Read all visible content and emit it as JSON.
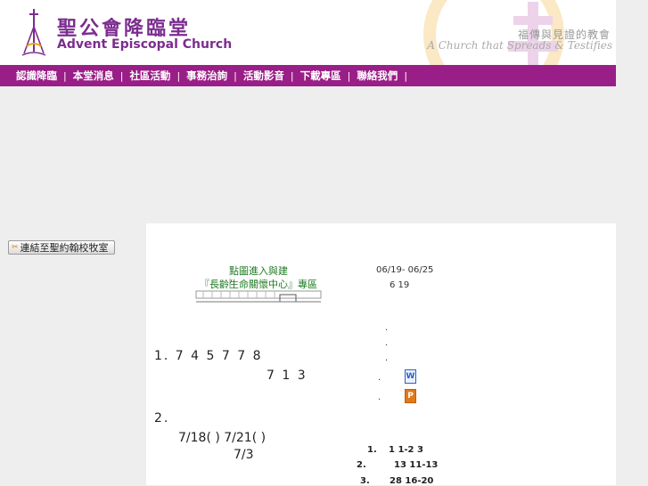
{
  "header": {
    "church_name_cn": "聖公會降臨堂",
    "church_name_en": "Advent Episcopal Church",
    "slogan_cn": "福傳與見證的教會",
    "slogan_en": "A Church that Spreads & Testifies"
  },
  "nav": {
    "items": [
      "認識降臨",
      "本堂消息",
      "社區活動",
      "事務治詢",
      "活動影音",
      "下載專區",
      "聯絡我們"
    ],
    "separator": "|"
  },
  "sidebar": {
    "link_button_label": "連結至聖約翰校牧室"
  },
  "content": {
    "banner_line1": "點圖進入與建",
    "banner_line2": "『長齡生命關懷中心』專區",
    "date_range": "06/19- 06/25",
    "date_sub": "6 19",
    "dot": ".",
    "word_icon_glyph": "W",
    "ppt_icon_glyph": "P",
    "item1_line1": "1. 7 4    5    7 7    8",
    "item1_line2": "7 1   3",
    "item2_line1": "2.",
    "item2_line2": "7/18( ) 7/21( )",
    "item2_line3": "7/3",
    "schedule": [
      {
        "num": "1.",
        "text": "1  1-2  3"
      },
      {
        "num": "2.",
        "text": "13  11-13"
      },
      {
        "num": "3.",
        "text": "28  16-20"
      }
    ]
  },
  "colors": {
    "brand_purple": "#9a1e87",
    "logo_purple": "#7b2d8e",
    "page_bg": "#eeeeee",
    "banner_green": "#1d7a20"
  },
  "icons": {
    "logo": "church-cross-logo",
    "background_cross": "cross-icon",
    "link_button": "link-icon",
    "word_doc": "word-document-icon",
    "ppt_doc": "powerpoint-document-icon"
  }
}
